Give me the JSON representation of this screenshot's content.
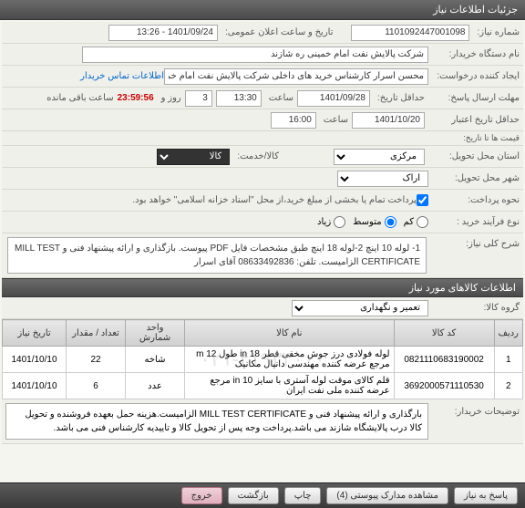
{
  "titlebar": "جزئیات اطلاعات نیاز",
  "form": {
    "need_no_label": "شماره نیاز:",
    "need_no": "1101092447001098",
    "announce_label": "تاریخ و ساعت اعلان عمومی:",
    "announce_value": "1401/09/24 - 13:26",
    "buyer_label": "نام دستگاه خریدار:",
    "buyer_value": "شرکت پالایش نفت امام خمینی ره شازند",
    "creator_label": "ایجاد کننده درخواست:",
    "creator_value": "محسن اسرار کارشناس خرید های داخلی شرکت پالایش نفت امام خمینی ره",
    "contact_link": "اطلاعات تماس خریدار",
    "deadline_label": "حداقل تاریخ:",
    "deadline_date": "1401/09/28",
    "deadline_time_label": "ساعت",
    "deadline_time": "13:30",
    "days_label": "روز و",
    "days_value": "3",
    "timer": "23:59:56",
    "remain_label": "ساعت باقی مانده",
    "send_label": "مهلت ارسال پاسخ:",
    "validity_label": "حداقل تاریخ اعتبار",
    "validity_sub": "قیمت ها تا تاریخ:",
    "validity_date": "1401/10/20",
    "validity_time": "16:00",
    "delivery_label": "استان محل تحویل:",
    "delivery_province": "مرکزی",
    "city_label": "شهر محل تحویل:",
    "city": "اراک",
    "item_service_label": "کالا/خدمت:",
    "item_service": "کالا",
    "payment_label": "نحوه پرداخت:",
    "payment_note": "پرداخت تمام یا بخشی از مبلغ خرید،از محل \"اسناد خزانه اسلامی\" خواهد بود.",
    "process_label": "نوع فرآیند خرید :",
    "process_options": [
      "کم",
      "متوسط",
      "زیاد"
    ],
    "process_selected": "متوسط",
    "desc_label": "شرح کلی نیاز:",
    "desc_text": "1- لوله 10 اینچ 2-لوله 18 اینچ طبق مشخصات فایل PDF پیوست. بازگذاری و ارائه پیشنهاد فنی و MILL TEST CERTIFICATE الزامیست. تلفن: 08633492836 آقای اسرار",
    "group_label": "گروه کالا:",
    "group_value": "تعمیر و نگهداری",
    "remarks_label": "توضیحات خریدار:",
    "remarks_text": "بارگذاری و ارائه پیشنهاد فنی و MILL TEST CERTIFICATE الزامیست.هزینه حمل بعهده فروشنده و تحویل کالا درب پالایشگاه شازند می باشد.پرداخت وجه پس از تحویل کالا و تاییدیه کارشناس فنی می باشد."
  },
  "section2_title": "اطلاعات کالاهای مورد نیاز",
  "table": {
    "headers": [
      "ردیف",
      "کد کالا",
      "نام کالا",
      "واحد شمارش",
      "تعداد / مقدار",
      "تاریخ نیاز"
    ],
    "rows": [
      {
        "idx": "1",
        "code": "0821110683190002",
        "name": "لوله فولادی درز جوش مخفی قطر 18 in طول 12 m مرجع عرضه کننده مهندسی دانیال مکانیک",
        "unit": "شاخه",
        "qty": "22",
        "date": "1401/10/10"
      },
      {
        "idx": "2",
        "code": "3692000571110530",
        "name": "قلم کالای موقت لوله آستری با سایز 10 in مرجع عرضه کننده ملی نفت ایران",
        "unit": "عدد",
        "qty": "6",
        "date": "1401/10/10"
      }
    ]
  },
  "watermark": "۰۲۱-۴۱۹۳۴۰۰۰",
  "buttons": {
    "respond": "پاسخ به نیاز",
    "attachments": "مشاهده مدارک پیوستی (4)",
    "print": "چاپ",
    "back": "بازگشت",
    "exit": "خروج"
  }
}
